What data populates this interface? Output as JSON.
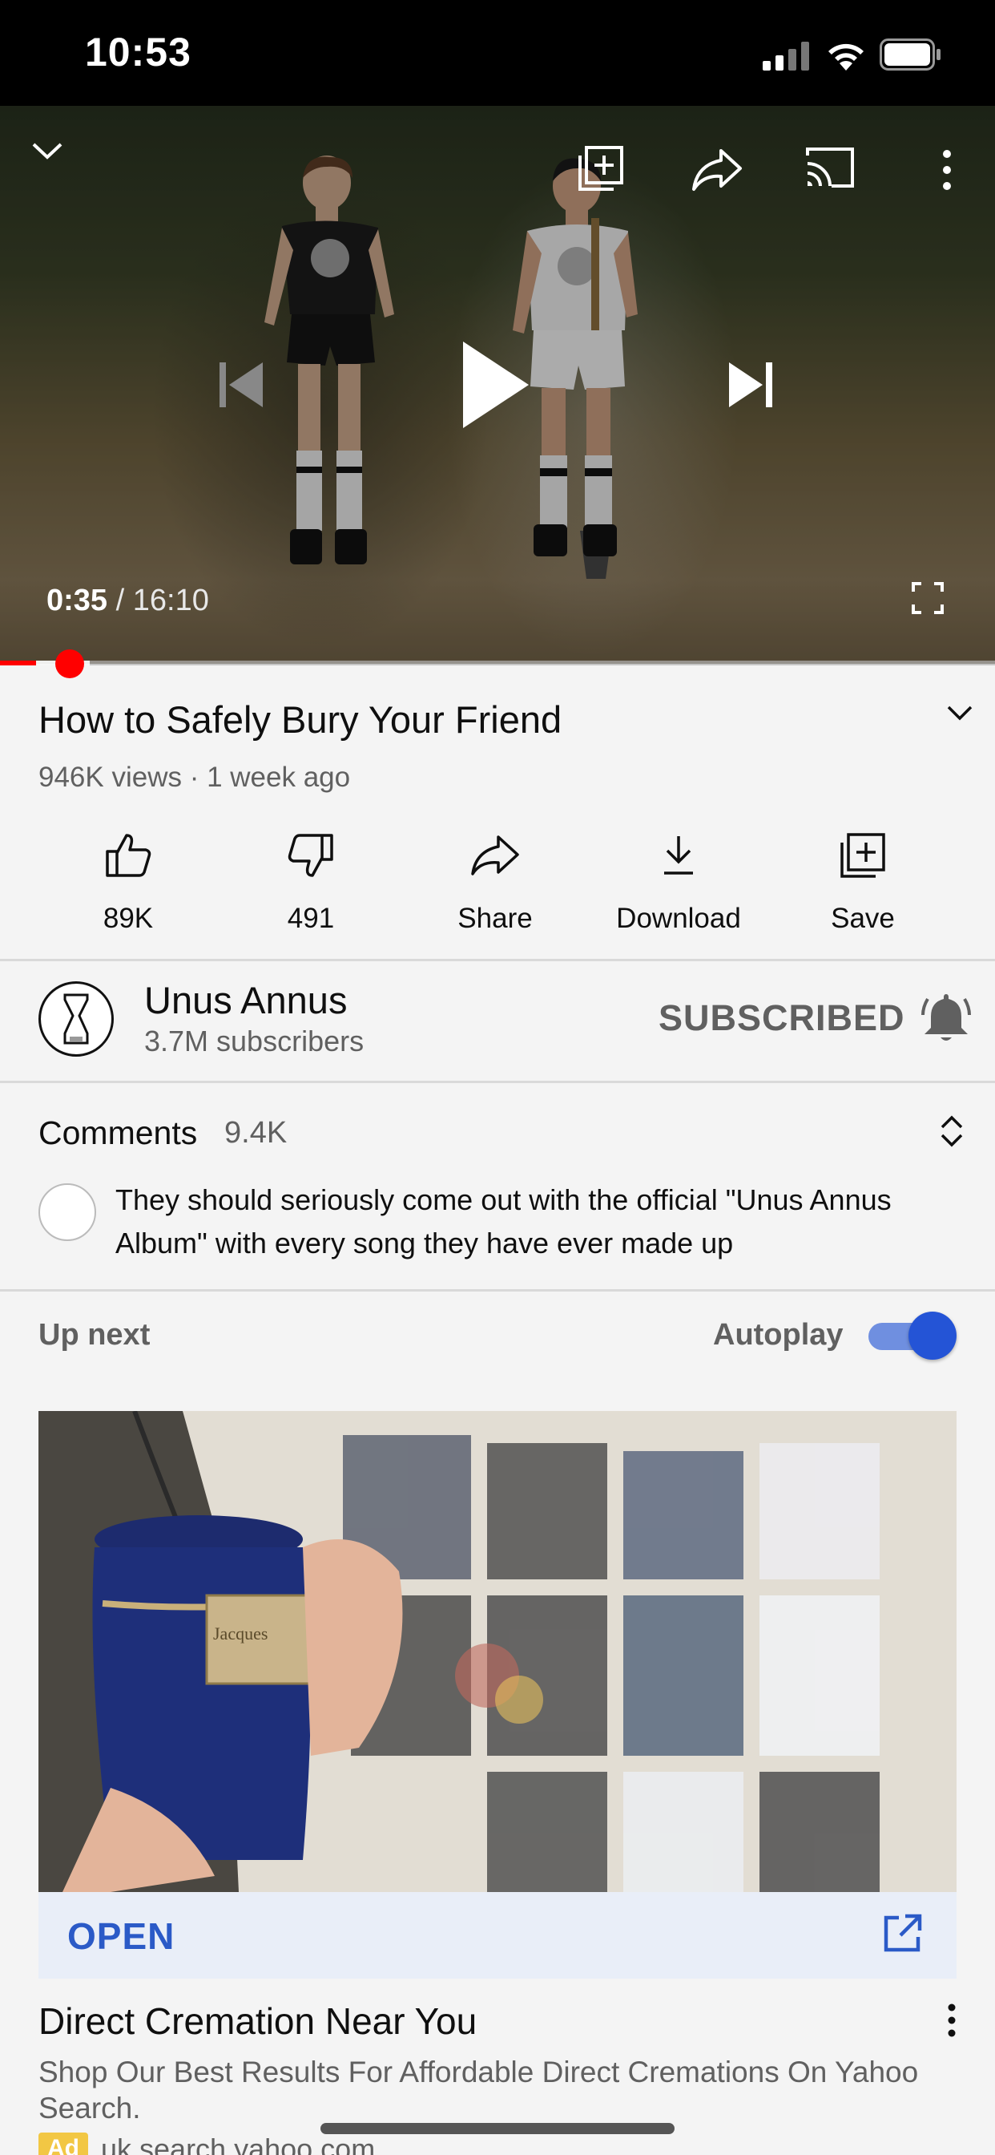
{
  "status_bar": {
    "time": "10:53"
  },
  "player": {
    "current_time": "0:35",
    "separator": " / ",
    "duration": "16:10",
    "progress": 0.036,
    "buffered": 0.09
  },
  "video": {
    "title": "How to Safely Bury Your Friend",
    "meta": "946K views · 1 week ago"
  },
  "actions": [
    {
      "label": "89K",
      "icon": "thumbs-up-icon"
    },
    {
      "label": "491",
      "icon": "thumbs-down-icon"
    },
    {
      "label": "Share",
      "icon": "share-icon"
    },
    {
      "label": "Download",
      "icon": "download-icon"
    },
    {
      "label": "Save",
      "icon": "save-to-playlist-icon"
    }
  ],
  "channel": {
    "name": "Unus Annus",
    "subscribers": "3.7M subscribers",
    "subscribe_state": "SUBSCRIBED"
  },
  "comments": {
    "title": "Comments",
    "count": "9.4K",
    "top_comment": "They should seriously come out with the official \"Unus Annus Album\" with every song they have ever made up"
  },
  "up_next": {
    "label": "Up next",
    "autoplay_label": "Autoplay",
    "autoplay_on": true
  },
  "ad": {
    "cta": "OPEN",
    "title": "Direct Cremation Near You",
    "description": "Shop Our Best Results For Affordable Direct Cremations On Yahoo Search.",
    "badge": "Ad",
    "domain": "uk.search.yahoo.com",
    "urn_plate": "Jacques"
  },
  "colors": {
    "accent_red": "#ff0000",
    "link_blue": "#2b5ac7",
    "toggle_blue": "#2454d6"
  }
}
